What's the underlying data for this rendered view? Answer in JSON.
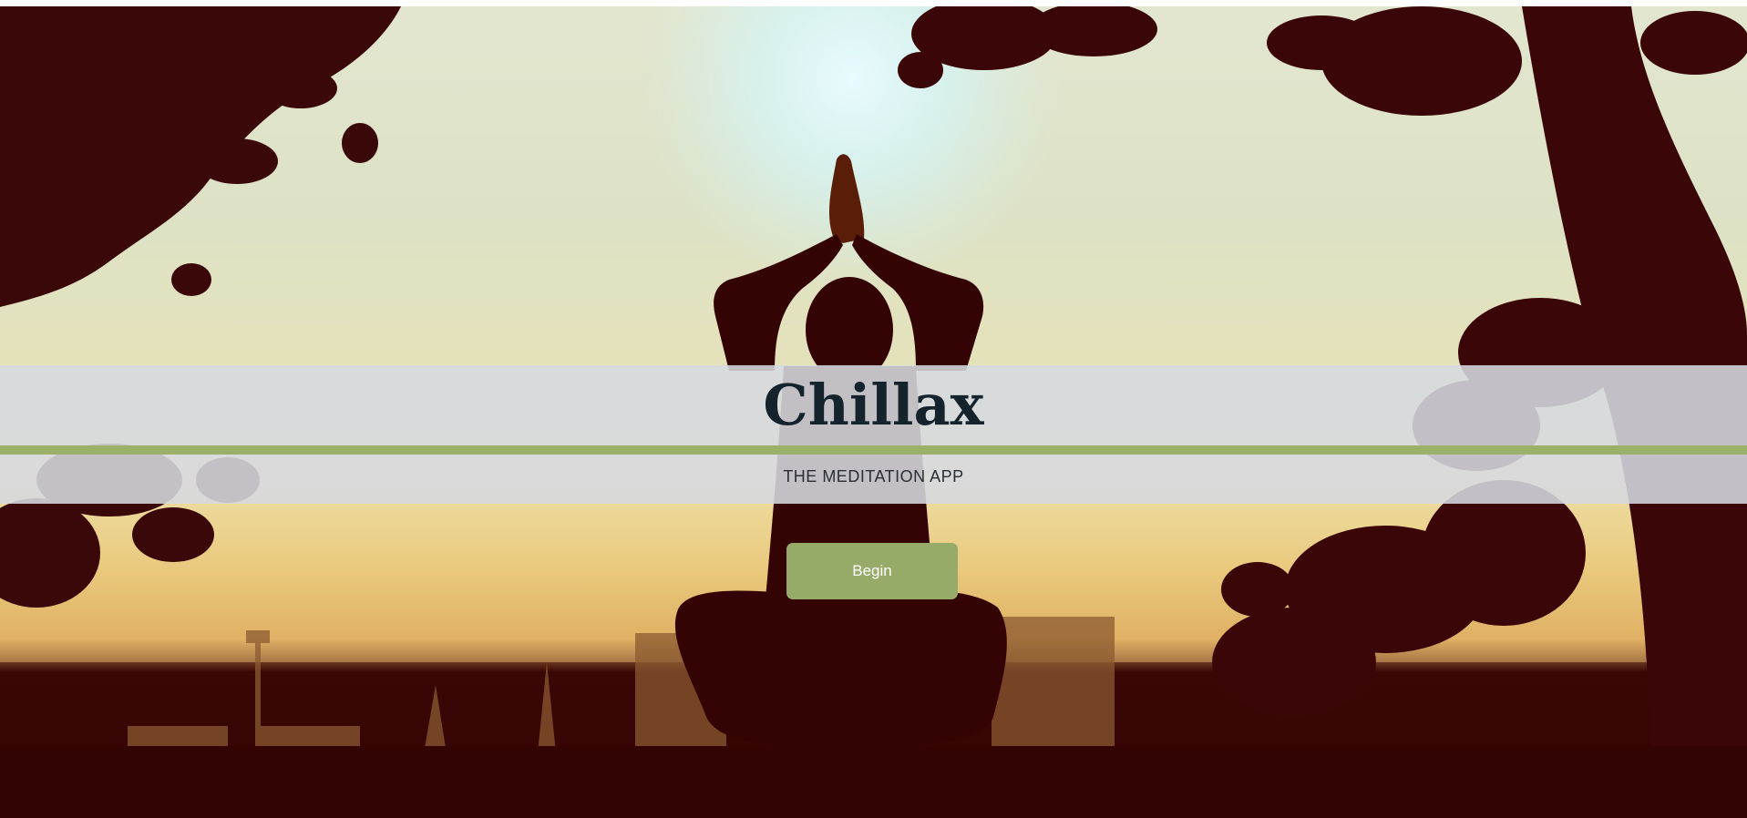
{
  "hero": {
    "title": "Chillax",
    "subtitle": "THE MEDITATION APP",
    "begin_label": "Begin"
  },
  "colors": {
    "accent_green": "#96ab68",
    "band_line": "#9bb06a",
    "title_text": "#15232d",
    "silhouette": "#340405"
  }
}
